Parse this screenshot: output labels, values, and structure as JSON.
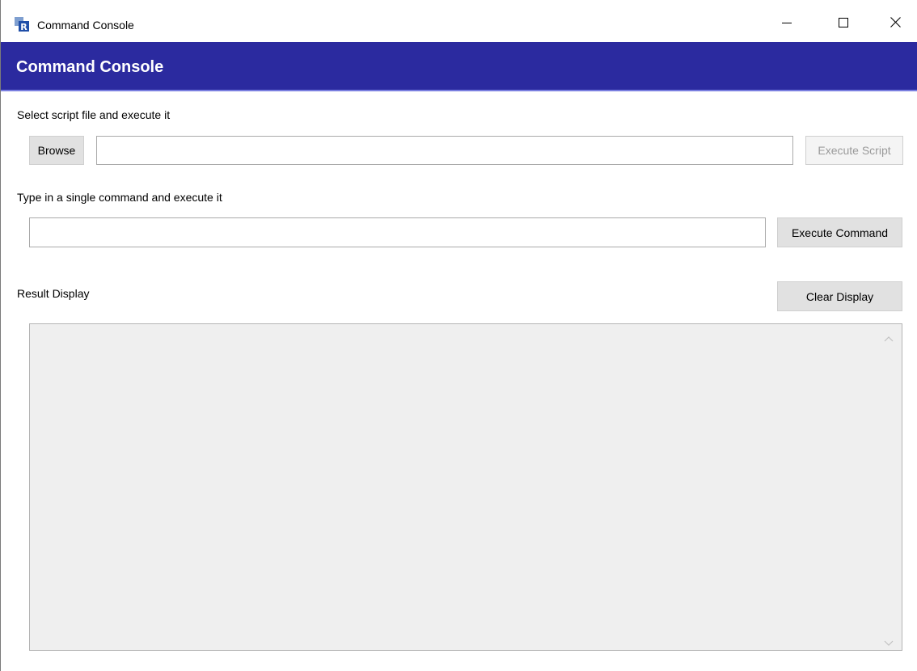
{
  "window": {
    "title": "Command Console",
    "icon": "r-app-icon",
    "controls": {
      "minimize_icon": "minimize-icon",
      "maximize_icon": "maximize-icon",
      "close_icon": "close-icon"
    }
  },
  "header": {
    "title": "Command Console",
    "color": "#2b2a9f"
  },
  "script_section": {
    "label": "Select script file and execute it",
    "browse_label": "Browse",
    "file_path_value": "",
    "execute_label": "Execute Script",
    "execute_enabled": false
  },
  "command_section": {
    "label": "Type in a single command and execute it",
    "command_value": "",
    "execute_label": "Execute Command"
  },
  "result_section": {
    "label": "Result Display",
    "clear_label": "Clear Display",
    "content": ""
  }
}
